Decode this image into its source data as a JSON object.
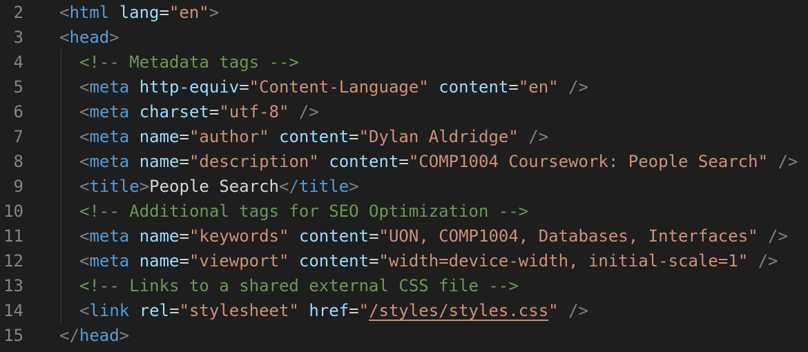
{
  "editor": {
    "theme_colors": {
      "background": "#1e1e1e",
      "line_number": "#858585",
      "punctuation": "#808080",
      "tag": "#569cd6",
      "attribute": "#9cdcfe",
      "string": "#ce9178",
      "comment": "#6a9955",
      "text": "#d4d4d4"
    },
    "lines": [
      {
        "number": "2",
        "indent": 1,
        "tokens": [
          {
            "t": "punct",
            "v": "<"
          },
          {
            "t": "tag",
            "v": "html"
          },
          {
            "t": "text",
            "v": " "
          },
          {
            "t": "attr",
            "v": "lang"
          },
          {
            "t": "eq",
            "v": "="
          },
          {
            "t": "str",
            "v": "\"en\""
          },
          {
            "t": "punct",
            "v": ">"
          }
        ]
      },
      {
        "number": "3",
        "indent": 1,
        "tokens": [
          {
            "t": "punct",
            "v": "<"
          },
          {
            "t": "tag",
            "v": "head"
          },
          {
            "t": "punct",
            "v": ">"
          }
        ]
      },
      {
        "number": "4",
        "indent": 2,
        "tokens": [
          {
            "t": "comment",
            "v": "<!-- Metadata tags -->"
          }
        ]
      },
      {
        "number": "5",
        "indent": 2,
        "tokens": [
          {
            "t": "punct",
            "v": "<"
          },
          {
            "t": "tag",
            "v": "meta"
          },
          {
            "t": "text",
            "v": " "
          },
          {
            "t": "attr",
            "v": "http-equiv"
          },
          {
            "t": "eq",
            "v": "="
          },
          {
            "t": "str",
            "v": "\"Content-Language\""
          },
          {
            "t": "text",
            "v": " "
          },
          {
            "t": "attr",
            "v": "content"
          },
          {
            "t": "eq",
            "v": "="
          },
          {
            "t": "str",
            "v": "\"en\""
          },
          {
            "t": "text",
            "v": " "
          },
          {
            "t": "punct",
            "v": "/>"
          }
        ]
      },
      {
        "number": "6",
        "indent": 2,
        "tokens": [
          {
            "t": "punct",
            "v": "<"
          },
          {
            "t": "tag",
            "v": "meta"
          },
          {
            "t": "text",
            "v": " "
          },
          {
            "t": "attr",
            "v": "charset"
          },
          {
            "t": "eq",
            "v": "="
          },
          {
            "t": "str",
            "v": "\"utf-8\""
          },
          {
            "t": "text",
            "v": " "
          },
          {
            "t": "punct",
            "v": "/>"
          }
        ]
      },
      {
        "number": "7",
        "indent": 2,
        "tokens": [
          {
            "t": "punct",
            "v": "<"
          },
          {
            "t": "tag",
            "v": "meta"
          },
          {
            "t": "text",
            "v": " "
          },
          {
            "t": "attr",
            "v": "name"
          },
          {
            "t": "eq",
            "v": "="
          },
          {
            "t": "str",
            "v": "\"author\""
          },
          {
            "t": "text",
            "v": " "
          },
          {
            "t": "attr",
            "v": "content"
          },
          {
            "t": "eq",
            "v": "="
          },
          {
            "t": "str",
            "v": "\"Dylan Aldridge\""
          },
          {
            "t": "text",
            "v": " "
          },
          {
            "t": "punct",
            "v": "/>"
          }
        ]
      },
      {
        "number": "8",
        "indent": 2,
        "tokens": [
          {
            "t": "punct",
            "v": "<"
          },
          {
            "t": "tag",
            "v": "meta"
          },
          {
            "t": "text",
            "v": " "
          },
          {
            "t": "attr",
            "v": "name"
          },
          {
            "t": "eq",
            "v": "="
          },
          {
            "t": "str",
            "v": "\"description\""
          },
          {
            "t": "text",
            "v": " "
          },
          {
            "t": "attr",
            "v": "content"
          },
          {
            "t": "eq",
            "v": "="
          },
          {
            "t": "str",
            "v": "\"COMP1004 Coursework: People Search\""
          },
          {
            "t": "text",
            "v": " "
          },
          {
            "t": "punct",
            "v": "/>"
          }
        ]
      },
      {
        "number": "9",
        "indent": 2,
        "tokens": [
          {
            "t": "punct",
            "v": "<"
          },
          {
            "t": "tag",
            "v": "title"
          },
          {
            "t": "punct",
            "v": ">"
          },
          {
            "t": "text",
            "v": "People Search"
          },
          {
            "t": "punct",
            "v": "</"
          },
          {
            "t": "tag",
            "v": "title"
          },
          {
            "t": "punct",
            "v": ">"
          }
        ]
      },
      {
        "number": "10",
        "indent": 2,
        "tokens": [
          {
            "t": "comment",
            "v": "<!-- Additional tags for SEO Optimization -->"
          }
        ]
      },
      {
        "number": "11",
        "indent": 2,
        "tokens": [
          {
            "t": "punct",
            "v": "<"
          },
          {
            "t": "tag",
            "v": "meta"
          },
          {
            "t": "text",
            "v": " "
          },
          {
            "t": "attr",
            "v": "name"
          },
          {
            "t": "eq",
            "v": "="
          },
          {
            "t": "str",
            "v": "\"keywords\""
          },
          {
            "t": "text",
            "v": " "
          },
          {
            "t": "attr",
            "v": "content"
          },
          {
            "t": "eq",
            "v": "="
          },
          {
            "t": "str",
            "v": "\"UON, COMP1004, Databases, Interfaces\""
          },
          {
            "t": "text",
            "v": " "
          },
          {
            "t": "punct",
            "v": "/>"
          }
        ]
      },
      {
        "number": "12",
        "indent": 2,
        "tokens": [
          {
            "t": "punct",
            "v": "<"
          },
          {
            "t": "tag",
            "v": "meta"
          },
          {
            "t": "text",
            "v": " "
          },
          {
            "t": "attr",
            "v": "name"
          },
          {
            "t": "eq",
            "v": "="
          },
          {
            "t": "str",
            "v": "\"viewport\""
          },
          {
            "t": "text",
            "v": " "
          },
          {
            "t": "attr",
            "v": "content"
          },
          {
            "t": "eq",
            "v": "="
          },
          {
            "t": "str",
            "v": "\"width=device-width, initial-scale=1\""
          },
          {
            "t": "text",
            "v": " "
          },
          {
            "t": "punct",
            "v": "/>"
          }
        ]
      },
      {
        "number": "13",
        "indent": 2,
        "tokens": [
          {
            "t": "comment",
            "v": "<!-- Links to a shared external CSS file -->"
          }
        ]
      },
      {
        "number": "14",
        "indent": 2,
        "tokens": [
          {
            "t": "punct",
            "v": "<"
          },
          {
            "t": "tag",
            "v": "link"
          },
          {
            "t": "text",
            "v": " "
          },
          {
            "t": "attr",
            "v": "rel"
          },
          {
            "t": "eq",
            "v": "="
          },
          {
            "t": "str",
            "v": "\"stylesheet\""
          },
          {
            "t": "text",
            "v": " "
          },
          {
            "t": "attr",
            "v": "href"
          },
          {
            "t": "eq",
            "v": "="
          },
          {
            "t": "str",
            "v": "\""
          },
          {
            "t": "link",
            "v": "/styles/styles.css"
          },
          {
            "t": "str",
            "v": "\""
          },
          {
            "t": "text",
            "v": " "
          },
          {
            "t": "punct",
            "v": "/>"
          }
        ]
      },
      {
        "number": "15",
        "indent": 1,
        "tokens": [
          {
            "t": "punct",
            "v": "</"
          },
          {
            "t": "tag",
            "v": "head"
          },
          {
            "t": "punct",
            "v": ">"
          }
        ]
      }
    ]
  }
}
